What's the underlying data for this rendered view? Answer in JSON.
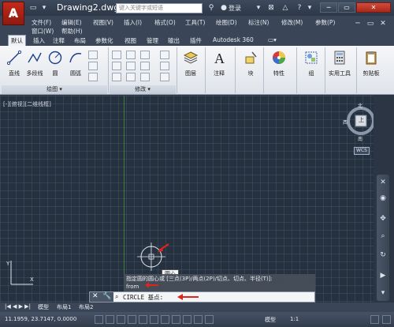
{
  "title": {
    "logo": "A",
    "document": "Drawing2.dwg",
    "search_placeholder": "键入关键字或短语",
    "login": "登录"
  },
  "menu": [
    "文件(F)",
    "编辑(E)",
    "视图(V)",
    "插入(I)",
    "格式(O)",
    "工具(T)",
    "绘图(D)",
    "标注(N)",
    "修改(M)",
    "参数(P)",
    "窗口(W)",
    "帮助(H)"
  ],
  "tabs": [
    "默认",
    "插入",
    "注释",
    "布局",
    "参数化",
    "视图",
    "管理",
    "输出",
    "插件",
    "Autodesk 360"
  ],
  "ribbon": {
    "draw": [
      "直线",
      "多段线",
      "圆",
      "圆弧"
    ],
    "draw_panel": "绘图",
    "modify_panel": "修改",
    "layers": "图层",
    "annotation": "注释",
    "block": "块",
    "properties": "特性",
    "groups": "组",
    "utilities": "实用工具",
    "clipboard": "剪贴板"
  },
  "viewport": {
    "label": "[-][俯视][二维线框]",
    "viewcube_top": "上",
    "compass_n": "北",
    "compass_s": "南",
    "compass_e": "东",
    "compass_w": "西",
    "wcs": "WCS"
  },
  "tooltip": "圆心",
  "command": {
    "history_line1": "指定圆的圆心或 [三点(3P)/两点(2P)/切点、切点、半径(T)]:",
    "history_line2": "from",
    "prompt": "CIRCLE 基点:"
  },
  "layout_tabs": [
    "模型",
    "布局1",
    "布局2"
  ],
  "status": {
    "coords": "11.1959, 23.7147, 0.0000",
    "model": "模型",
    "scale": "1:1"
  },
  "colors": {
    "canvas": "#263140",
    "accent_red": "#e0241b"
  }
}
